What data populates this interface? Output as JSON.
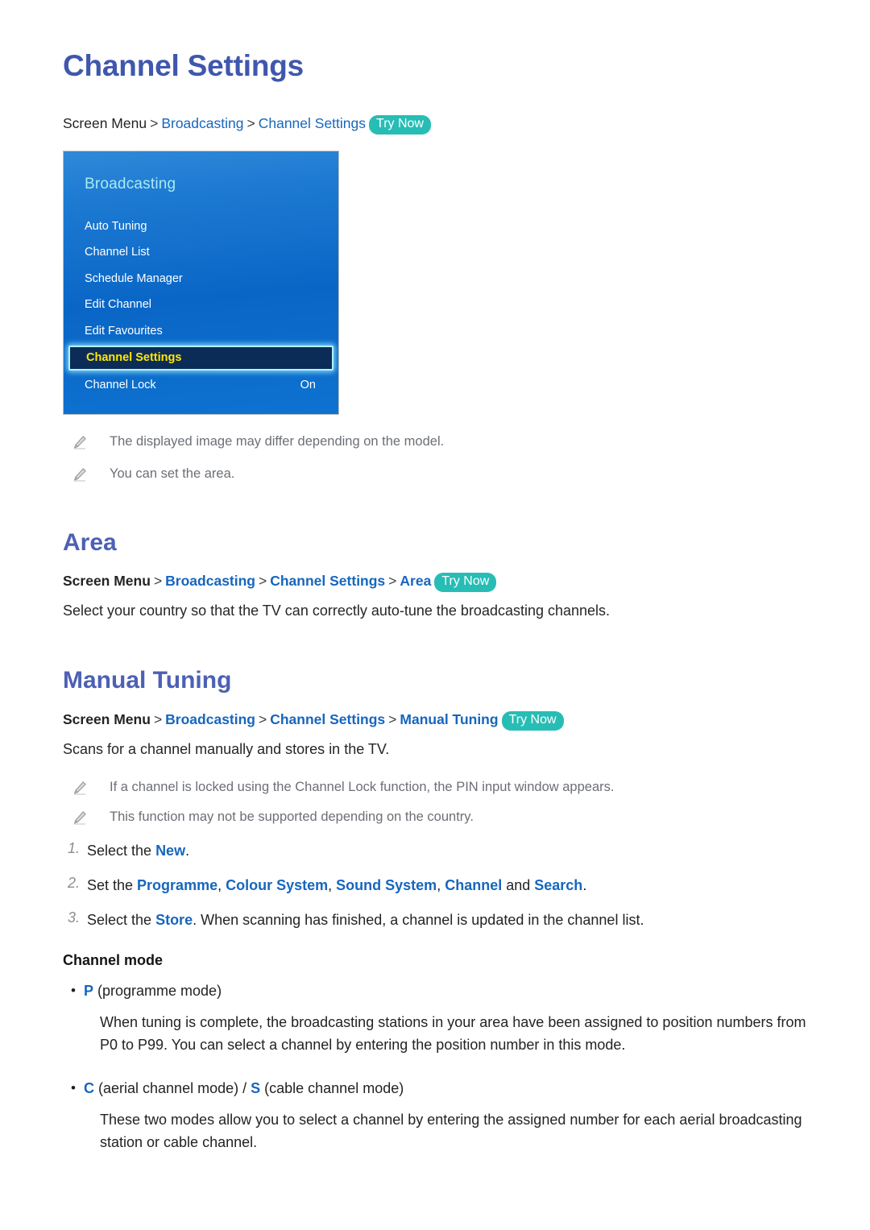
{
  "page": {
    "title": "Channel Settings"
  },
  "breadcrumbs": {
    "top": {
      "prefix": "Screen Menu",
      "sep": ">",
      "links": [
        "Broadcasting",
        "Channel Settings"
      ],
      "badge": "Try Now"
    },
    "area": {
      "prefix": "Screen Menu",
      "sep": ">",
      "links": [
        "Broadcasting",
        "Channel Settings",
        "Area"
      ],
      "badge": "Try Now"
    },
    "manual": {
      "prefix": "Screen Menu",
      "sep": ">",
      "links": [
        "Broadcasting",
        "Channel Settings",
        "Manual Tuning"
      ],
      "badge": "Try Now"
    }
  },
  "tv_menu": {
    "title": "Broadcasting",
    "items": [
      {
        "label": "Auto Tuning",
        "value": "",
        "selected": false
      },
      {
        "label": "Channel List",
        "value": "",
        "selected": false
      },
      {
        "label": "Schedule Manager",
        "value": "",
        "selected": false
      },
      {
        "label": "Edit Channel",
        "value": "",
        "selected": false
      },
      {
        "label": "Edit Favourites",
        "value": "",
        "selected": false
      },
      {
        "label": "Channel Settings",
        "value": "",
        "selected": true
      },
      {
        "label": "Channel Lock",
        "value": "On",
        "selected": false
      }
    ],
    "colors": {
      "panel_blue": "#0a66c6",
      "title_cyan": "#a9e9f2",
      "selected_bg": "#0c2c58",
      "selected_border": "#b3f0ff",
      "selected_text": "#ffe800"
    }
  },
  "notes_top": [
    {
      "icon": "pencil-icon",
      "text": "The displayed image may differ depending on the model."
    },
    {
      "icon": "pencil-icon",
      "text": "You can set the area."
    }
  ],
  "area_section": {
    "heading": "Area",
    "paragraph": "Select your country so that the TV can correctly auto-tune the broadcasting channels."
  },
  "manual_section": {
    "heading": "Manual Tuning",
    "paragraph": "Scans for a channel manually and stores in the TV.",
    "notes": [
      {
        "icon": "pencil-icon",
        "text": "If a channel is locked using the Channel Lock function, the PIN input window appears."
      },
      {
        "icon": "pencil-icon",
        "text": "This function may not be supported depending on the country."
      }
    ],
    "steps": [
      {
        "number": "1.",
        "parts": [
          {
            "t": "Select the ",
            "kw": false
          },
          {
            "t": "New",
            "kw": true
          },
          {
            "t": ".",
            "kw": false
          }
        ]
      },
      {
        "number": "2.",
        "parts": [
          {
            "t": "Set the ",
            "kw": false
          },
          {
            "t": "Programme",
            "kw": true
          },
          {
            "t": ", ",
            "kw": false
          },
          {
            "t": "Colour System",
            "kw": true
          },
          {
            "t": ", ",
            "kw": false
          },
          {
            "t": "Sound System",
            "kw": true
          },
          {
            "t": ", ",
            "kw": false
          },
          {
            "t": "Channel",
            "kw": true
          },
          {
            "t": " and ",
            "kw": false
          },
          {
            "t": "Search",
            "kw": true
          },
          {
            "t": ".",
            "kw": false
          }
        ]
      },
      {
        "number": "3.",
        "parts": [
          {
            "t": "Select the ",
            "kw": false
          },
          {
            "t": "Store",
            "kw": true
          },
          {
            "t": ". When scanning has finished, a channel is updated in the channel list.",
            "kw": false
          }
        ]
      }
    ],
    "channel_mode": {
      "subhead": "Channel mode",
      "modes": [
        {
          "bullet": "•",
          "parts": [
            {
              "t": "P",
              "kw": true
            },
            {
              "t": " (programme mode)",
              "kw": false
            }
          ],
          "body": "When tuning is complete, the broadcasting stations in your area have been assigned to position numbers from P0 to P99. You can select a channel by entering the position number in this mode."
        },
        {
          "bullet": "•",
          "parts": [
            {
              "t": "C",
              "kw": true
            },
            {
              "t": " (aerial channel mode) / ",
              "kw": false
            },
            {
              "t": "S",
              "kw": true
            },
            {
              "t": " (cable channel mode)",
              "kw": false
            }
          ],
          "body": "These two modes allow you to select a channel by entering the assigned number for each aerial broadcasting station or cable channel."
        }
      ]
    }
  },
  "colors": {
    "heading_blue": "#4c60b4",
    "link_blue": "#1766bd",
    "badge_teal": "#27bdb5",
    "note_gray": "#6c6f76"
  }
}
